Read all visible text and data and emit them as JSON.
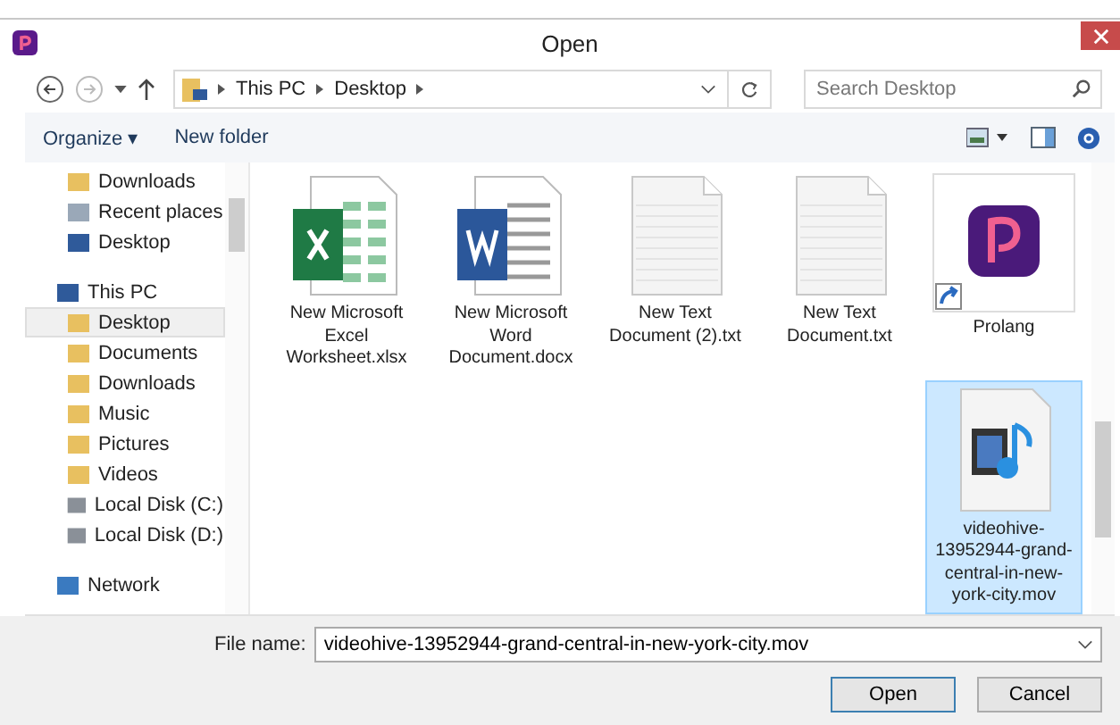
{
  "window": {
    "title": "Open"
  },
  "address": {
    "path": [
      "This PC",
      "Desktop"
    ]
  },
  "search": {
    "placeholder": "Search Desktop"
  },
  "toolbar": {
    "organize": "Organize ▾",
    "new_folder": "New folder"
  },
  "sidebar": {
    "items": [
      {
        "label": "Downloads",
        "kind": "downloads",
        "selected": false
      },
      {
        "label": "Recent places",
        "kind": "recent",
        "selected": false
      },
      {
        "label": "Desktop",
        "kind": "monitor",
        "selected": false
      },
      {
        "label": "This PC",
        "kind": "pc",
        "selected": false,
        "children": [
          {
            "label": "Desktop",
            "kind": "folder",
            "selected": true
          },
          {
            "label": "Documents",
            "kind": "folder",
            "selected": false
          },
          {
            "label": "Downloads",
            "kind": "downloads",
            "selected": false
          },
          {
            "label": "Music",
            "kind": "folder",
            "selected": false
          },
          {
            "label": "Pictures",
            "kind": "folder",
            "selected": false
          },
          {
            "label": "Videos",
            "kind": "folder",
            "selected": false
          },
          {
            "label": "Local Disk (C:)",
            "kind": "disk",
            "selected": false
          },
          {
            "label": "Local Disk (D:)",
            "kind": "disk",
            "selected": false
          }
        ]
      },
      {
        "label": "Network",
        "kind": "network",
        "selected": false
      }
    ]
  },
  "files": [
    {
      "name": "New Microsoft Excel Worksheet.xlsx",
      "kind": "excel",
      "selected": false
    },
    {
      "name": "New Microsoft Word Document.docx",
      "kind": "word",
      "selected": false
    },
    {
      "name": "New Text Document (2).txt",
      "kind": "text",
      "selected": false
    },
    {
      "name": "New Text Document.txt",
      "kind": "text",
      "selected": false
    },
    {
      "name": "Prolang",
      "kind": "shortcut",
      "selected": false
    },
    {
      "name": "videohive-13952944-grand-central-in-new-york-city.mov",
      "kind": "video",
      "selected": true
    }
  ],
  "footer": {
    "file_name_label": "File name:",
    "file_name": "videohive-13952944-grand-central-in-new-york-city.mov",
    "buttons": [
      "Open",
      "Cancel"
    ]
  }
}
